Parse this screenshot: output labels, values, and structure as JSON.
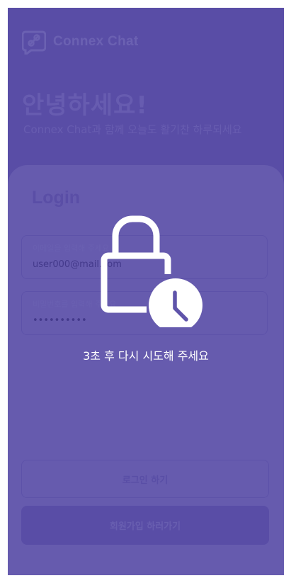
{
  "app": {
    "brand_name": "Connex Chat",
    "greeting": "안녕하세요!",
    "subgreeting": "Connex Chat과 함께 오늘도 활기찬 하루되세요"
  },
  "login_card": {
    "title": "Login",
    "email": {
      "label": "이메일을 입력해 주세요",
      "value": "user000@mail.com"
    },
    "password": {
      "label": "비밀번호를 입력해 주세요",
      "value": "••••••••••"
    },
    "login_button": "로그인 하기",
    "signup_button": "회원가입 하러가기"
  },
  "overlay": {
    "message": "3초 후 다시 시도해 주세요",
    "icon": "lock-clock-icon"
  },
  "colors": {
    "background": "#5a4ea6",
    "card": "#6a5fb0",
    "overlay_text": "#ffffff"
  }
}
